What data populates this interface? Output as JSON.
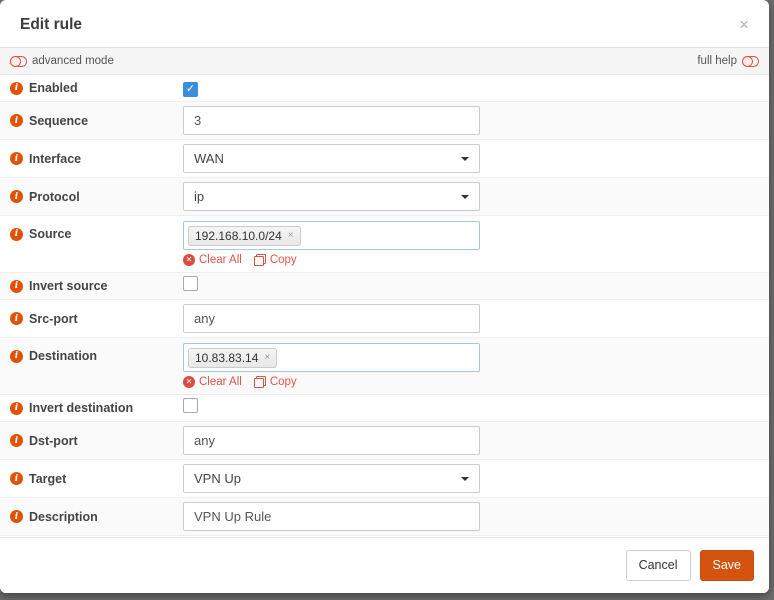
{
  "modal": {
    "title": "Edit rule",
    "close_icon": "×"
  },
  "mode_bar": {
    "advanced_mode_label": "advanced mode",
    "full_help_label": "full help"
  },
  "colors": {
    "accent_orange": "#d4530f",
    "info_icon_orange": "#e05206",
    "toggle_red": "#e0544a",
    "link_red": "#e0544a",
    "checkbox_blue": "#3c8ddc",
    "token_field_border": "#a9c6e2",
    "row_stripe": "#fafafa"
  },
  "form": {
    "rows": [
      {
        "label": "Enabled",
        "type": "checkbox",
        "checked": true
      },
      {
        "label": "Sequence",
        "type": "text",
        "value": "3"
      },
      {
        "label": "Interface",
        "type": "select",
        "value": "WAN"
      },
      {
        "label": "Protocol",
        "type": "select",
        "value": "ip"
      },
      {
        "label": "Source",
        "type": "tokens",
        "tokens": [
          "192.168.10.0/24"
        ]
      },
      {
        "label": "Invert source",
        "type": "checkbox",
        "checked": false
      },
      {
        "label": "Src-port",
        "type": "text",
        "value": "any"
      },
      {
        "label": "Destination",
        "type": "tokens",
        "tokens": [
          "10.83.83.14"
        ]
      },
      {
        "label": "Invert destination",
        "type": "checkbox",
        "checked": false
      },
      {
        "label": "Dst-port",
        "type": "text",
        "value": "any"
      },
      {
        "label": "Target",
        "type": "select",
        "value": "VPN Up"
      },
      {
        "label": "Description",
        "type": "text",
        "value": "VPN Up Rule"
      }
    ],
    "token_actions": {
      "clear_all_label": "Clear All",
      "copy_label": "Copy"
    },
    "token_remove_icon": "×",
    "checkbox_check_glyph": "✓"
  },
  "footer": {
    "cancel_label": "Cancel",
    "save_label": "Save"
  }
}
